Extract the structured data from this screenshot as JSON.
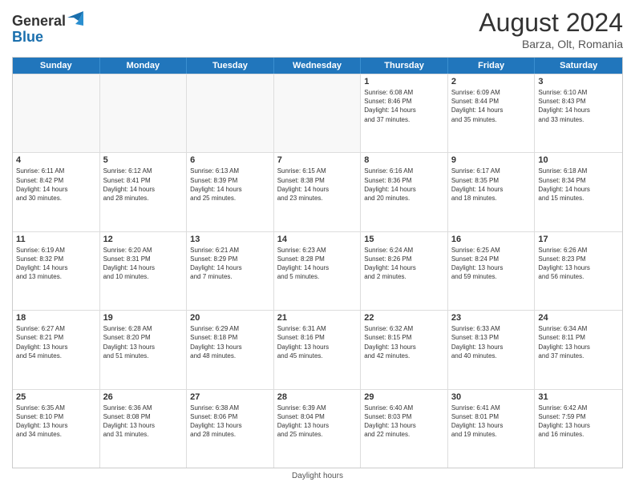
{
  "header": {
    "logo_line1": "General",
    "logo_line2": "Blue",
    "month_year": "August 2024",
    "location": "Barza, Olt, Romania"
  },
  "days_of_week": [
    "Sunday",
    "Monday",
    "Tuesday",
    "Wednesday",
    "Thursday",
    "Friday",
    "Saturday"
  ],
  "footer": {
    "note": "Daylight hours"
  },
  "weeks": [
    [
      {
        "day": "",
        "empty": true
      },
      {
        "day": "",
        "empty": true
      },
      {
        "day": "",
        "empty": true
      },
      {
        "day": "",
        "empty": true
      },
      {
        "day": "1",
        "line1": "Sunrise: 6:08 AM",
        "line2": "Sunset: 8:46 PM",
        "line3": "Daylight: 14 hours",
        "line4": "and 37 minutes."
      },
      {
        "day": "2",
        "line1": "Sunrise: 6:09 AM",
        "line2": "Sunset: 8:44 PM",
        "line3": "Daylight: 14 hours",
        "line4": "and 35 minutes."
      },
      {
        "day": "3",
        "line1": "Sunrise: 6:10 AM",
        "line2": "Sunset: 8:43 PM",
        "line3": "Daylight: 14 hours",
        "line4": "and 33 minutes."
      }
    ],
    [
      {
        "day": "4",
        "line1": "Sunrise: 6:11 AM",
        "line2": "Sunset: 8:42 PM",
        "line3": "Daylight: 14 hours",
        "line4": "and 30 minutes."
      },
      {
        "day": "5",
        "line1": "Sunrise: 6:12 AM",
        "line2": "Sunset: 8:41 PM",
        "line3": "Daylight: 14 hours",
        "line4": "and 28 minutes."
      },
      {
        "day": "6",
        "line1": "Sunrise: 6:13 AM",
        "line2": "Sunset: 8:39 PM",
        "line3": "Daylight: 14 hours",
        "line4": "and 25 minutes."
      },
      {
        "day": "7",
        "line1": "Sunrise: 6:15 AM",
        "line2": "Sunset: 8:38 PM",
        "line3": "Daylight: 14 hours",
        "line4": "and 23 minutes."
      },
      {
        "day": "8",
        "line1": "Sunrise: 6:16 AM",
        "line2": "Sunset: 8:36 PM",
        "line3": "Daylight: 14 hours",
        "line4": "and 20 minutes."
      },
      {
        "day": "9",
        "line1": "Sunrise: 6:17 AM",
        "line2": "Sunset: 8:35 PM",
        "line3": "Daylight: 14 hours",
        "line4": "and 18 minutes."
      },
      {
        "day": "10",
        "line1": "Sunrise: 6:18 AM",
        "line2": "Sunset: 8:34 PM",
        "line3": "Daylight: 14 hours",
        "line4": "and 15 minutes."
      }
    ],
    [
      {
        "day": "11",
        "line1": "Sunrise: 6:19 AM",
        "line2": "Sunset: 8:32 PM",
        "line3": "Daylight: 14 hours",
        "line4": "and 13 minutes."
      },
      {
        "day": "12",
        "line1": "Sunrise: 6:20 AM",
        "line2": "Sunset: 8:31 PM",
        "line3": "Daylight: 14 hours",
        "line4": "and 10 minutes."
      },
      {
        "day": "13",
        "line1": "Sunrise: 6:21 AM",
        "line2": "Sunset: 8:29 PM",
        "line3": "Daylight: 14 hours",
        "line4": "and 7 minutes."
      },
      {
        "day": "14",
        "line1": "Sunrise: 6:23 AM",
        "line2": "Sunset: 8:28 PM",
        "line3": "Daylight: 14 hours",
        "line4": "and 5 minutes."
      },
      {
        "day": "15",
        "line1": "Sunrise: 6:24 AM",
        "line2": "Sunset: 8:26 PM",
        "line3": "Daylight: 14 hours",
        "line4": "and 2 minutes."
      },
      {
        "day": "16",
        "line1": "Sunrise: 6:25 AM",
        "line2": "Sunset: 8:24 PM",
        "line3": "Daylight: 13 hours",
        "line4": "and 59 minutes."
      },
      {
        "day": "17",
        "line1": "Sunrise: 6:26 AM",
        "line2": "Sunset: 8:23 PM",
        "line3": "Daylight: 13 hours",
        "line4": "and 56 minutes."
      }
    ],
    [
      {
        "day": "18",
        "line1": "Sunrise: 6:27 AM",
        "line2": "Sunset: 8:21 PM",
        "line3": "Daylight: 13 hours",
        "line4": "and 54 minutes."
      },
      {
        "day": "19",
        "line1": "Sunrise: 6:28 AM",
        "line2": "Sunset: 8:20 PM",
        "line3": "Daylight: 13 hours",
        "line4": "and 51 minutes."
      },
      {
        "day": "20",
        "line1": "Sunrise: 6:29 AM",
        "line2": "Sunset: 8:18 PM",
        "line3": "Daylight: 13 hours",
        "line4": "and 48 minutes."
      },
      {
        "day": "21",
        "line1": "Sunrise: 6:31 AM",
        "line2": "Sunset: 8:16 PM",
        "line3": "Daylight: 13 hours",
        "line4": "and 45 minutes."
      },
      {
        "day": "22",
        "line1": "Sunrise: 6:32 AM",
        "line2": "Sunset: 8:15 PM",
        "line3": "Daylight: 13 hours",
        "line4": "and 42 minutes."
      },
      {
        "day": "23",
        "line1": "Sunrise: 6:33 AM",
        "line2": "Sunset: 8:13 PM",
        "line3": "Daylight: 13 hours",
        "line4": "and 40 minutes."
      },
      {
        "day": "24",
        "line1": "Sunrise: 6:34 AM",
        "line2": "Sunset: 8:11 PM",
        "line3": "Daylight: 13 hours",
        "line4": "and 37 minutes."
      }
    ],
    [
      {
        "day": "25",
        "line1": "Sunrise: 6:35 AM",
        "line2": "Sunset: 8:10 PM",
        "line3": "Daylight: 13 hours",
        "line4": "and 34 minutes."
      },
      {
        "day": "26",
        "line1": "Sunrise: 6:36 AM",
        "line2": "Sunset: 8:08 PM",
        "line3": "Daylight: 13 hours",
        "line4": "and 31 minutes."
      },
      {
        "day": "27",
        "line1": "Sunrise: 6:38 AM",
        "line2": "Sunset: 8:06 PM",
        "line3": "Daylight: 13 hours",
        "line4": "and 28 minutes."
      },
      {
        "day": "28",
        "line1": "Sunrise: 6:39 AM",
        "line2": "Sunset: 8:04 PM",
        "line3": "Daylight: 13 hours",
        "line4": "and 25 minutes."
      },
      {
        "day": "29",
        "line1": "Sunrise: 6:40 AM",
        "line2": "Sunset: 8:03 PM",
        "line3": "Daylight: 13 hours",
        "line4": "and 22 minutes."
      },
      {
        "day": "30",
        "line1": "Sunrise: 6:41 AM",
        "line2": "Sunset: 8:01 PM",
        "line3": "Daylight: 13 hours",
        "line4": "and 19 minutes."
      },
      {
        "day": "31",
        "line1": "Sunrise: 6:42 AM",
        "line2": "Sunset: 7:59 PM",
        "line3": "Daylight: 13 hours",
        "line4": "and 16 minutes."
      }
    ]
  ]
}
